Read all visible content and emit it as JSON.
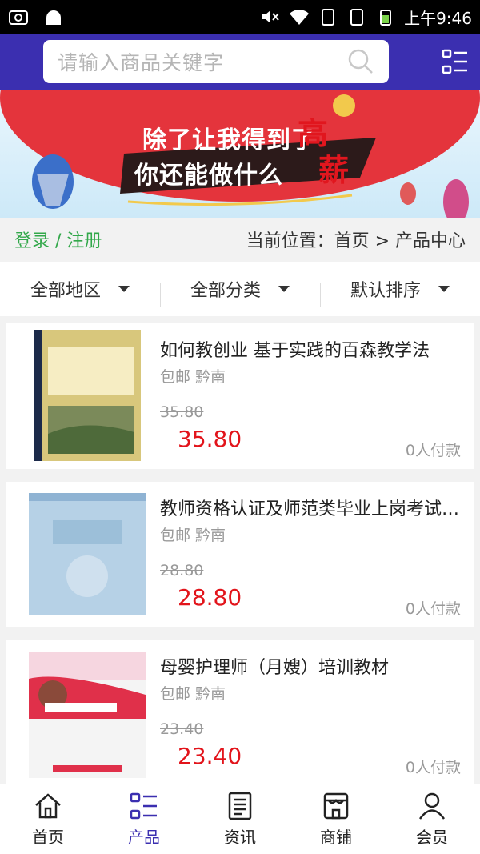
{
  "status_bar": {
    "time": "上午9:46"
  },
  "search": {
    "placeholder": "请输入商品关键字"
  },
  "banner": {
    "line1": "除了让我得到了",
    "line2": "你还能做什么",
    "big1": "高",
    "big2": "薪"
  },
  "breadcrumb": {
    "login": "登录 / 注册",
    "location": "当前位置：首页 > 产品中心"
  },
  "filters": [
    {
      "label": "全部地区"
    },
    {
      "label": "全部分类"
    },
    {
      "label": "默认排序"
    }
  ],
  "products": [
    {
      "title": "如何教创业 基于实践的百森教学法",
      "meta": "包邮 黔南",
      "old_price": "35.80",
      "price": "35.80",
      "sold": "0人付款",
      "cover_color": "#c8b36a"
    },
    {
      "title": "教师资格认证及师范类毕业上岗考试辅导教材",
      "meta": "包邮 黔南",
      "old_price": "28.80",
      "price": "28.80",
      "sold": "0人付款",
      "cover_color": "#a9c6de"
    },
    {
      "title": "母婴护理师（月嫂）培训教材",
      "meta": "包邮 黔南",
      "old_price": "23.40",
      "price": "23.40",
      "sold": "0人付款",
      "cover_color": "#e0304a"
    }
  ],
  "tabs": [
    {
      "label": "首页",
      "icon": "home-icon"
    },
    {
      "label": "产品",
      "icon": "list-icon"
    },
    {
      "label": "资讯",
      "icon": "news-icon"
    },
    {
      "label": "商铺",
      "icon": "shop-icon"
    },
    {
      "label": "会员",
      "icon": "user-icon"
    }
  ],
  "colors": {
    "brand": "#3b2fb0",
    "price": "#e2141b",
    "login": "#32a84a"
  }
}
